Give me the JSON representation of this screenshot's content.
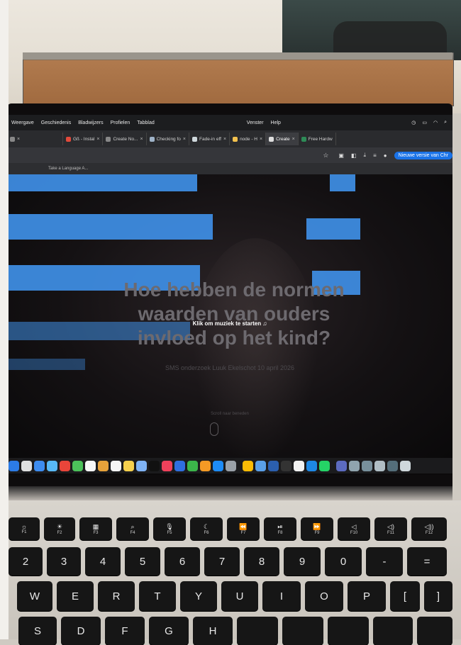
{
  "menubar": {
    "items": [
      "Weergave",
      "Geschiedenis",
      "Bladwijzers",
      "Profielen",
      "Tabblad"
    ],
    "right_items": [
      "Venster",
      "Help"
    ]
  },
  "tabs": [
    {
      "label": "Gß - Instal"
    },
    {
      "label": "Create No..."
    },
    {
      "label": "Checking fo"
    },
    {
      "label": "Fade-in eff"
    },
    {
      "label": "node - H"
    },
    {
      "label": "Create"
    },
    {
      "label": "Free Hardw"
    }
  ],
  "address": {
    "update_button": "Nieuwe versie van Chr"
  },
  "bookmarks": [
    "Take a Language A..."
  ],
  "page": {
    "title_line1": "Hoe hebben de normen",
    "title_line2": "waarden van ouders",
    "title_line3": "invloed op het kind?",
    "music_prompt": "Klik om muziek te starten ♫",
    "subtitle": "SMS onderzoek Luuk Ekelschot 10 april 2026",
    "scroll_hint": "Scroll naar beneden"
  },
  "keyboard": {
    "fn_row": [
      "F1",
      "F2",
      "F3",
      "F4",
      "F5",
      "F6",
      "F7",
      "F8",
      "F9",
      "F10",
      "F11",
      "F12"
    ],
    "number_row": [
      "2",
      "3",
      "4",
      "5",
      "6",
      "7",
      "8",
      "9",
      "0",
      "-",
      "="
    ],
    "top_row": [
      "W",
      "E",
      "R",
      "T",
      "Y",
      "U",
      "I",
      "O",
      "P",
      "[",
      "]"
    ],
    "home_row": [
      "S",
      "D",
      "F",
      "G",
      "H"
    ]
  },
  "colors": {
    "accent_blue": "#3f8fe6",
    "update_button": "#1a73e8"
  }
}
